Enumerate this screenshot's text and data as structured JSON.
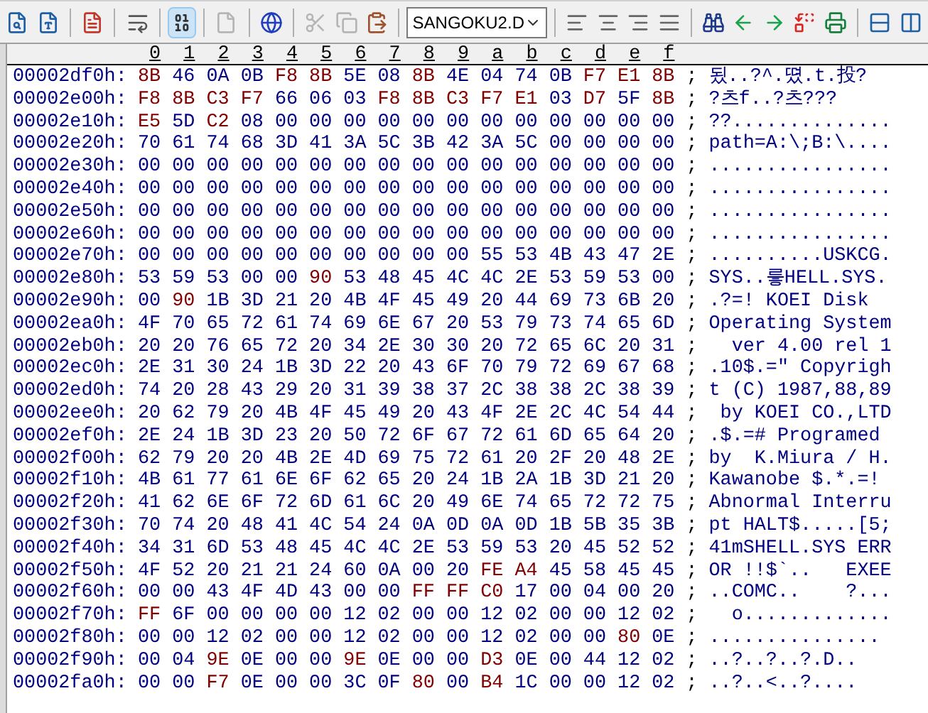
{
  "toolbar": {
    "groups": [
      [
        {
          "selected": false,
          "disabled": false
        },
        {
          "selected": false,
          "disabled": false
        }
      ],
      [
        {
          "selected": false,
          "disabled": false
        }
      ],
      [
        {
          "selected": false,
          "disabled": false
        }
      ],
      [
        {
          "selected": true,
          "disabled": false
        }
      ],
      [
        {
          "selected": false,
          "disabled": true
        }
      ],
      [
        {
          "selected": false,
          "disabled": false
        }
      ],
      [
        {
          "selected": false,
          "disabled": true
        },
        {
          "selected": false,
          "disabled": true
        },
        {
          "selected": false,
          "disabled": false
        }
      ]
    ],
    "file_select": "SANGOKU2.D",
    "groups_after": [
      [
        {
          "selected": false,
          "disabled": false
        },
        {
          "selected": false,
          "disabled": false
        },
        {
          "selected": false,
          "disabled": false
        },
        {
          "selected": false,
          "disabled": false
        }
      ],
      [
        {
          "selected": false,
          "disabled": false
        },
        {
          "selected": false,
          "disabled": false
        },
        {
          "selected": false,
          "disabled": false
        },
        {
          "selected": false,
          "disabled": false
        },
        {
          "selected": false,
          "disabled": false
        }
      ],
      [
        {
          "selected": false,
          "disabled": false
        },
        {
          "selected": false,
          "disabled": false
        }
      ]
    ]
  },
  "columns": [
    "0",
    "1",
    "2",
    "3",
    "4",
    "5",
    "6",
    "7",
    "8",
    "9",
    "a",
    "b",
    "c",
    "d",
    "e",
    "f"
  ],
  "rows": [
    {
      "offset": "00002df0h:",
      "bytes": [
        "8B",
        "46",
        "0A",
        "0B",
        "F8",
        "8B",
        "5E",
        "08",
        "8B",
        "4E",
        "04",
        "74",
        "0B",
        "F7",
        "E1",
        "8B"
      ],
      "sep": ";",
      "text": "됬..?^.뗬.t.投?"
    },
    {
      "offset": "00002e00h:",
      "bytes": [
        "F8",
        "8B",
        "C3",
        "F7",
        "66",
        "06",
        "03",
        "F8",
        "8B",
        "C3",
        "F7",
        "E1",
        "03",
        "D7",
        "5F",
        "8B"
      ],
      "sep": ";",
      "text": "?츠f..?츠???"
    },
    {
      "offset": "00002e10h:",
      "bytes": [
        "E5",
        "5D",
        "C2",
        "08",
        "00",
        "00",
        "00",
        "00",
        "00",
        "00",
        "00",
        "00",
        "00",
        "00",
        "00",
        "00"
      ],
      "sep": ";",
      "text": "??.............."
    },
    {
      "offset": "00002e20h:",
      "bytes": [
        "70",
        "61",
        "74",
        "68",
        "3D",
        "41",
        "3A",
        "5C",
        "3B",
        "42",
        "3A",
        "5C",
        "00",
        "00",
        "00",
        "00"
      ],
      "sep": ";",
      "text": "path=A:\\;B:\\...."
    },
    {
      "offset": "00002e30h:",
      "bytes": [
        "00",
        "00",
        "00",
        "00",
        "00",
        "00",
        "00",
        "00",
        "00",
        "00",
        "00",
        "00",
        "00",
        "00",
        "00",
        "00"
      ],
      "sep": ";",
      "text": "................"
    },
    {
      "offset": "00002e40h:",
      "bytes": [
        "00",
        "00",
        "00",
        "00",
        "00",
        "00",
        "00",
        "00",
        "00",
        "00",
        "00",
        "00",
        "00",
        "00",
        "00",
        "00"
      ],
      "sep": ";",
      "text": "................"
    },
    {
      "offset": "00002e50h:",
      "bytes": [
        "00",
        "00",
        "00",
        "00",
        "00",
        "00",
        "00",
        "00",
        "00",
        "00",
        "00",
        "00",
        "00",
        "00",
        "00",
        "00"
      ],
      "sep": ";",
      "text": "................"
    },
    {
      "offset": "00002e60h:",
      "bytes": [
        "00",
        "00",
        "00",
        "00",
        "00",
        "00",
        "00",
        "00",
        "00",
        "00",
        "00",
        "00",
        "00",
        "00",
        "00",
        "00"
      ],
      "sep": ";",
      "text": "................"
    },
    {
      "offset": "00002e70h:",
      "bytes": [
        "00",
        "00",
        "00",
        "00",
        "00",
        "00",
        "00",
        "00",
        "00",
        "00",
        "55",
        "53",
        "4B",
        "43",
        "47",
        "2E"
      ],
      "sep": ";",
      "text": "..........USKCG."
    },
    {
      "offset": "00002e80h:",
      "bytes": [
        "53",
        "59",
        "53",
        "00",
        "00",
        "90",
        "53",
        "48",
        "45",
        "4C",
        "4C",
        "2E",
        "53",
        "59",
        "53",
        "00"
      ],
      "sep": ";",
      "text": "SYS..릏HELL.SYS."
    },
    {
      "offset": "00002e90h:",
      "bytes": [
        "00",
        "90",
        "1B",
        "3D",
        "21",
        "20",
        "4B",
        "4F",
        "45",
        "49",
        "20",
        "44",
        "69",
        "73",
        "6B",
        "20"
      ],
      "sep": ";",
      "text": ".?=! KOEI Disk "
    },
    {
      "offset": "00002ea0h:",
      "bytes": [
        "4F",
        "70",
        "65",
        "72",
        "61",
        "74",
        "69",
        "6E",
        "67",
        "20",
        "53",
        "79",
        "73",
        "74",
        "65",
        "6D"
      ],
      "sep": ";",
      "text": "Operating System"
    },
    {
      "offset": "00002eb0h:",
      "bytes": [
        "20",
        "20",
        "76",
        "65",
        "72",
        "20",
        "34",
        "2E",
        "30",
        "30",
        "20",
        "72",
        "65",
        "6C",
        "20",
        "31"
      ],
      "sep": ";",
      "text": "  ver 4.00 rel 1"
    },
    {
      "offset": "00002ec0h:",
      "bytes": [
        "2E",
        "31",
        "30",
        "24",
        "1B",
        "3D",
        "22",
        "20",
        "43",
        "6F",
        "70",
        "79",
        "72",
        "69",
        "67",
        "68"
      ],
      "sep": ";",
      "text": ".10$.=\" Copyrigh"
    },
    {
      "offset": "00002ed0h:",
      "bytes": [
        "74",
        "20",
        "28",
        "43",
        "29",
        "20",
        "31",
        "39",
        "38",
        "37",
        "2C",
        "38",
        "38",
        "2C",
        "38",
        "39"
      ],
      "sep": ";",
      "text": "t (C) 1987,88,89"
    },
    {
      "offset": "00002ee0h:",
      "bytes": [
        "20",
        "62",
        "79",
        "20",
        "4B",
        "4F",
        "45",
        "49",
        "20",
        "43",
        "4F",
        "2E",
        "2C",
        "4C",
        "54",
        "44"
      ],
      "sep": ";",
      "text": " by KOEI CO.,LTD"
    },
    {
      "offset": "00002ef0h:",
      "bytes": [
        "2E",
        "24",
        "1B",
        "3D",
        "23",
        "20",
        "50",
        "72",
        "6F",
        "67",
        "72",
        "61",
        "6D",
        "65",
        "64",
        "20"
      ],
      "sep": ";",
      "text": ".$.=# Programed "
    },
    {
      "offset": "00002f00h:",
      "bytes": [
        "62",
        "79",
        "20",
        "20",
        "4B",
        "2E",
        "4D",
        "69",
        "75",
        "72",
        "61",
        "20",
        "2F",
        "20",
        "48",
        "2E"
      ],
      "sep": ";",
      "text": "by  K.Miura / H."
    },
    {
      "offset": "00002f10h:",
      "bytes": [
        "4B",
        "61",
        "77",
        "61",
        "6E",
        "6F",
        "62",
        "65",
        "20",
        "24",
        "1B",
        "2A",
        "1B",
        "3D",
        "21",
        "20"
      ],
      "sep": ";",
      "text": "Kawanobe $.*.=! "
    },
    {
      "offset": "00002f20h:",
      "bytes": [
        "41",
        "62",
        "6E",
        "6F",
        "72",
        "6D",
        "61",
        "6C",
        "20",
        "49",
        "6E",
        "74",
        "65",
        "72",
        "72",
        "75"
      ],
      "sep": ";",
      "text": "Abnormal Interru"
    },
    {
      "offset": "00002f30h:",
      "bytes": [
        "70",
        "74",
        "20",
        "48",
        "41",
        "4C",
        "54",
        "24",
        "0A",
        "0D",
        "0A",
        "0D",
        "1B",
        "5B",
        "35",
        "3B"
      ],
      "sep": ";",
      "text": "pt HALT$.....[5;"
    },
    {
      "offset": "00002f40h:",
      "bytes": [
        "34",
        "31",
        "6D",
        "53",
        "48",
        "45",
        "4C",
        "4C",
        "2E",
        "53",
        "59",
        "53",
        "20",
        "45",
        "52",
        "52"
      ],
      "sep": ";",
      "text": "41mSHELL.SYS ERR"
    },
    {
      "offset": "00002f50h:",
      "bytes": [
        "4F",
        "52",
        "20",
        "21",
        "21",
        "24",
        "60",
        "0A",
        "00",
        "20",
        "FE",
        "A4",
        "45",
        "58",
        "45",
        "45"
      ],
      "sep": ";",
      "text": "OR !!$`..   EXEE"
    },
    {
      "offset": "00002f60h:",
      "bytes": [
        "00",
        "00",
        "43",
        "4F",
        "4D",
        "43",
        "00",
        "00",
        "FF",
        "FF",
        "C0",
        "17",
        "00",
        "04",
        "00",
        "20"
      ],
      "sep": ";",
      "text": "..COMC..    ?..."
    },
    {
      "offset": "00002f70h:",
      "bytes": [
        "FF",
        "6F",
        "00",
        "00",
        "00",
        "00",
        "12",
        "02",
        "00",
        "00",
        "12",
        "02",
        "00",
        "00",
        "12",
        "02"
      ],
      "sep": ";",
      "text": "  o............."
    },
    {
      "offset": "00002f80h:",
      "bytes": [
        "00",
        "00",
        "12",
        "02",
        "00",
        "00",
        "12",
        "02",
        "00",
        "00",
        "12",
        "02",
        "00",
        "00",
        "80",
        "0E"
      ],
      "sep": ";",
      "text": "..............."
    },
    {
      "offset": "00002f90h:",
      "bytes": [
        "00",
        "04",
        "9E",
        "0E",
        "00",
        "00",
        "9E",
        "0E",
        "00",
        "00",
        "D3",
        "0E",
        "00",
        "44",
        "12",
        "02"
      ],
      "sep": ";",
      "text": "..?..?..?.D.."
    },
    {
      "offset": "00002fa0h:",
      "bytes": [
        "00",
        "00",
        "F7",
        "0E",
        "00",
        "00",
        "3C",
        "0F",
        "80",
        "00",
        "B4",
        "1C",
        "00",
        "00",
        "12",
        "02"
      ],
      "sep": ";",
      "text": "..?..<..?...."
    }
  ]
}
